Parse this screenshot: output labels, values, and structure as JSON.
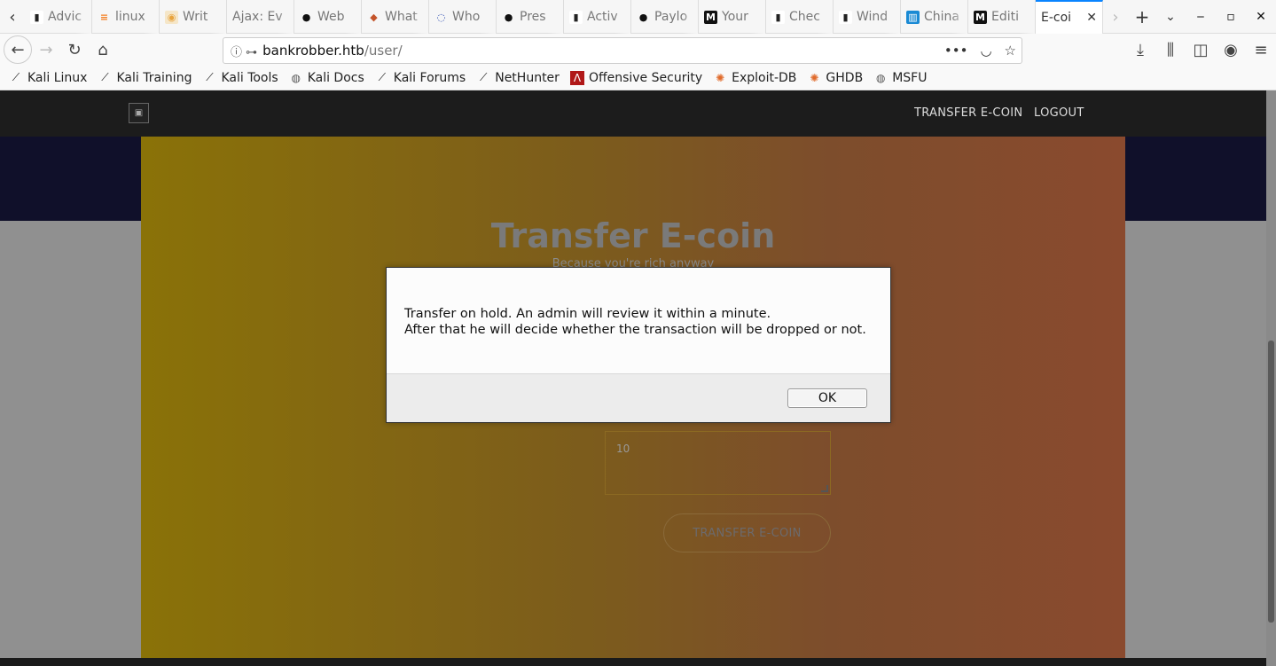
{
  "tabs": [
    {
      "label": "Advic",
      "icon": "dark-icon"
    },
    {
      "label": "linux",
      "icon": "stackoverflow-icon"
    },
    {
      "label": "Writ",
      "icon": "notes-icon"
    },
    {
      "label": "Ajax: Ev",
      "icon": ""
    },
    {
      "label": "Web",
      "icon": "github-icon"
    },
    {
      "label": "What",
      "icon": "brave-icon"
    },
    {
      "label": "Who",
      "icon": "spin-icon"
    },
    {
      "label": "Pres",
      "icon": "github-icon"
    },
    {
      "label": "Activ",
      "icon": "dark-icon"
    },
    {
      "label": "Paylo",
      "icon": "github-icon"
    },
    {
      "label": "Your",
      "icon": "medium-icon"
    },
    {
      "label": "Chec",
      "icon": "dark-icon"
    },
    {
      "label": "Wind",
      "icon": "dark-icon"
    },
    {
      "label": "China",
      "icon": "blue-icon"
    },
    {
      "label": "Editi",
      "icon": "medium-icon"
    }
  ],
  "active_tab": {
    "label": "E-coi",
    "close": "✕"
  },
  "url": {
    "host": "bankrobber.htb",
    "path": "/user/"
  },
  "bookmarks": [
    {
      "label": "Kali Linux",
      "icon": "kali-icon"
    },
    {
      "label": "Kali Training",
      "icon": "kali-icon"
    },
    {
      "label": "Kali Tools",
      "icon": "kali-icon"
    },
    {
      "label": "Kali Docs",
      "icon": "globe-icon"
    },
    {
      "label": "Kali Forums",
      "icon": "kali-icon"
    },
    {
      "label": "NetHunter",
      "icon": "kali-icon"
    },
    {
      "label": "Offensive Security",
      "icon": "offsec-icon"
    },
    {
      "label": "Exploit-DB",
      "icon": "exploitdb-icon"
    },
    {
      "label": "GHDB",
      "icon": "exploitdb-icon"
    },
    {
      "label": "MSFU",
      "icon": "globe-icon"
    }
  ],
  "site": {
    "nav_transfer": "TRANSFER E-COIN",
    "nav_logout": "LOGOUT",
    "title": "Transfer E-coin",
    "subtitle": "Because you're rich anyway",
    "amount_value": "10",
    "transfer_button": "TRANSFER E-COIN"
  },
  "dialog": {
    "message": "Transfer on hold. An admin will review it within a minute.\nAfter that he will decide whether the transaction will be dropped or not.",
    "ok": "OK"
  }
}
